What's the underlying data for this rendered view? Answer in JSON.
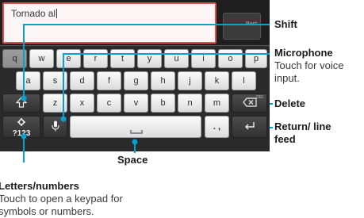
{
  "phone_screen": {
    "typed_text": "Tornado al",
    "send_button_label": "Post"
  },
  "keyboard": {
    "row1": [
      "q",
      "w",
      "e",
      "r",
      "t",
      "y",
      "u",
      "i",
      "o",
      "p"
    ],
    "row2": [
      "a",
      "s",
      "d",
      "f",
      "g",
      "h",
      "j",
      "k",
      "l"
    ],
    "row3": [
      "z",
      "x",
      "c",
      "v",
      "b",
      "n",
      "m"
    ],
    "symbols_key_label": "?123",
    "punctuation_key_label": ". ,",
    "delete_hint": "DEL"
  },
  "callouts": {
    "shift": {
      "label": "Shift"
    },
    "microphone": {
      "label": "Microphone",
      "description": "Touch for voice input."
    },
    "delete": {
      "label": "Delete"
    },
    "return": {
      "label": "Return/ line feed"
    },
    "space": {
      "label": "Space"
    },
    "letters_numbers": {
      "label": "Letters/numbers",
      "description": "Touch to open a keypad for symbols or numbers."
    }
  },
  "colors": {
    "callout_line": "#00a3d1",
    "text_field_border": "#d9534f",
    "keyboard_background": "#2a2a2a"
  }
}
